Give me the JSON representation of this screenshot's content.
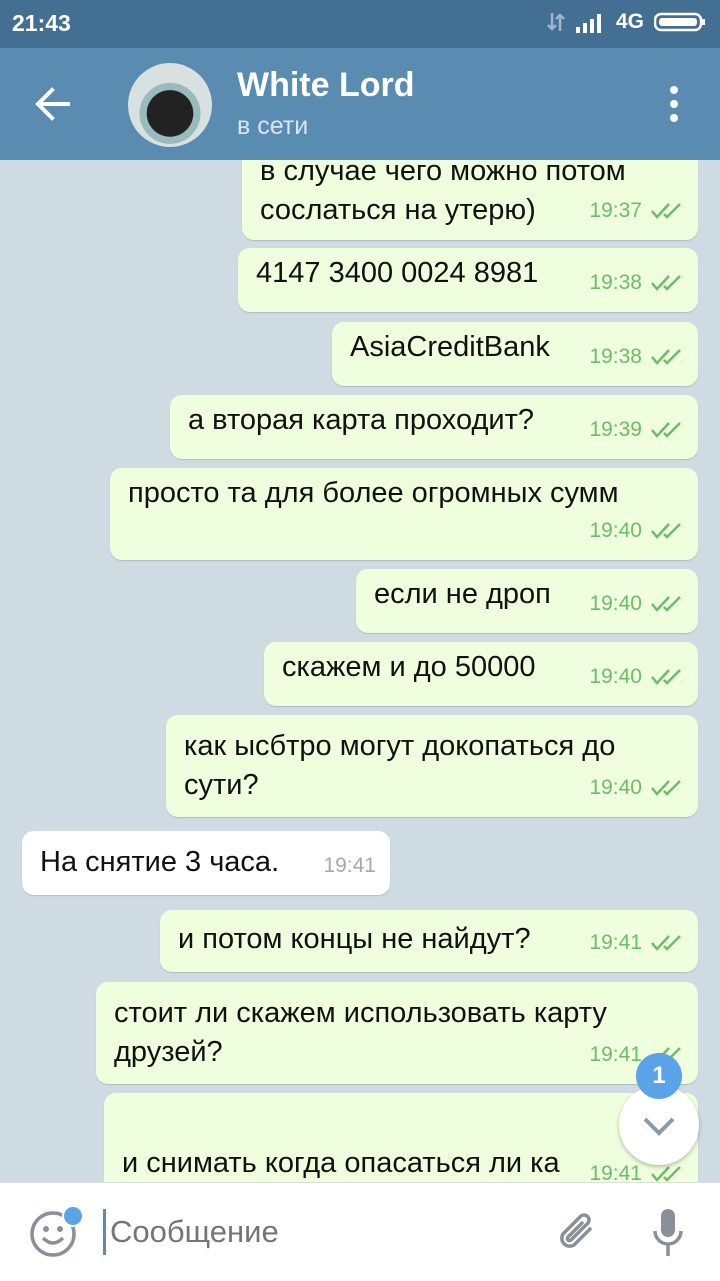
{
  "status_bar": {
    "time": "21:43",
    "network": "4G"
  },
  "header": {
    "contact_name": "White Lord",
    "status": "в сети"
  },
  "messages": [
    {
      "text": "в случае чего можно потом сослаться на утерю)",
      "time": "19:37"
    },
    {
      "text": "4147 3400 0024 8981",
      "time": "19:38"
    },
    {
      "text": "AsiaCreditBank",
      "time": "19:38"
    },
    {
      "text": "а вторая карта проходит?",
      "time": "19:39"
    },
    {
      "text": "просто та для более огромных сумм",
      "time": "19:40"
    },
    {
      "text": "если не дроп",
      "time": "19:40"
    },
    {
      "text": "скажем и до 50000",
      "time": "19:40"
    },
    {
      "text": "как ысбтро могут докопаться до сути?",
      "time": "19:40"
    },
    {
      "text": "На снятие 3 часа.",
      "time": "19:41"
    },
    {
      "text": "и потом концы не найдут?",
      "time": "19:41"
    },
    {
      "text": "стоит ли скажем использовать карту друзей?",
      "time": "19:41"
    },
    {
      "text": "и снимать когда опасаться ли ка\nбанкомата?",
      "time": "19:41"
    }
  ],
  "composer": {
    "placeholder": "Сообщение"
  },
  "scroll_down": {
    "unread_count": "1"
  },
  "colors": {
    "header": "#5a8bb1",
    "status_bar": "#436f93",
    "outgoing_bubble": "#effedd",
    "incoming_bubble": "#ffffff",
    "check_color": "#6fbb68",
    "accent": "#5aa3e8"
  }
}
